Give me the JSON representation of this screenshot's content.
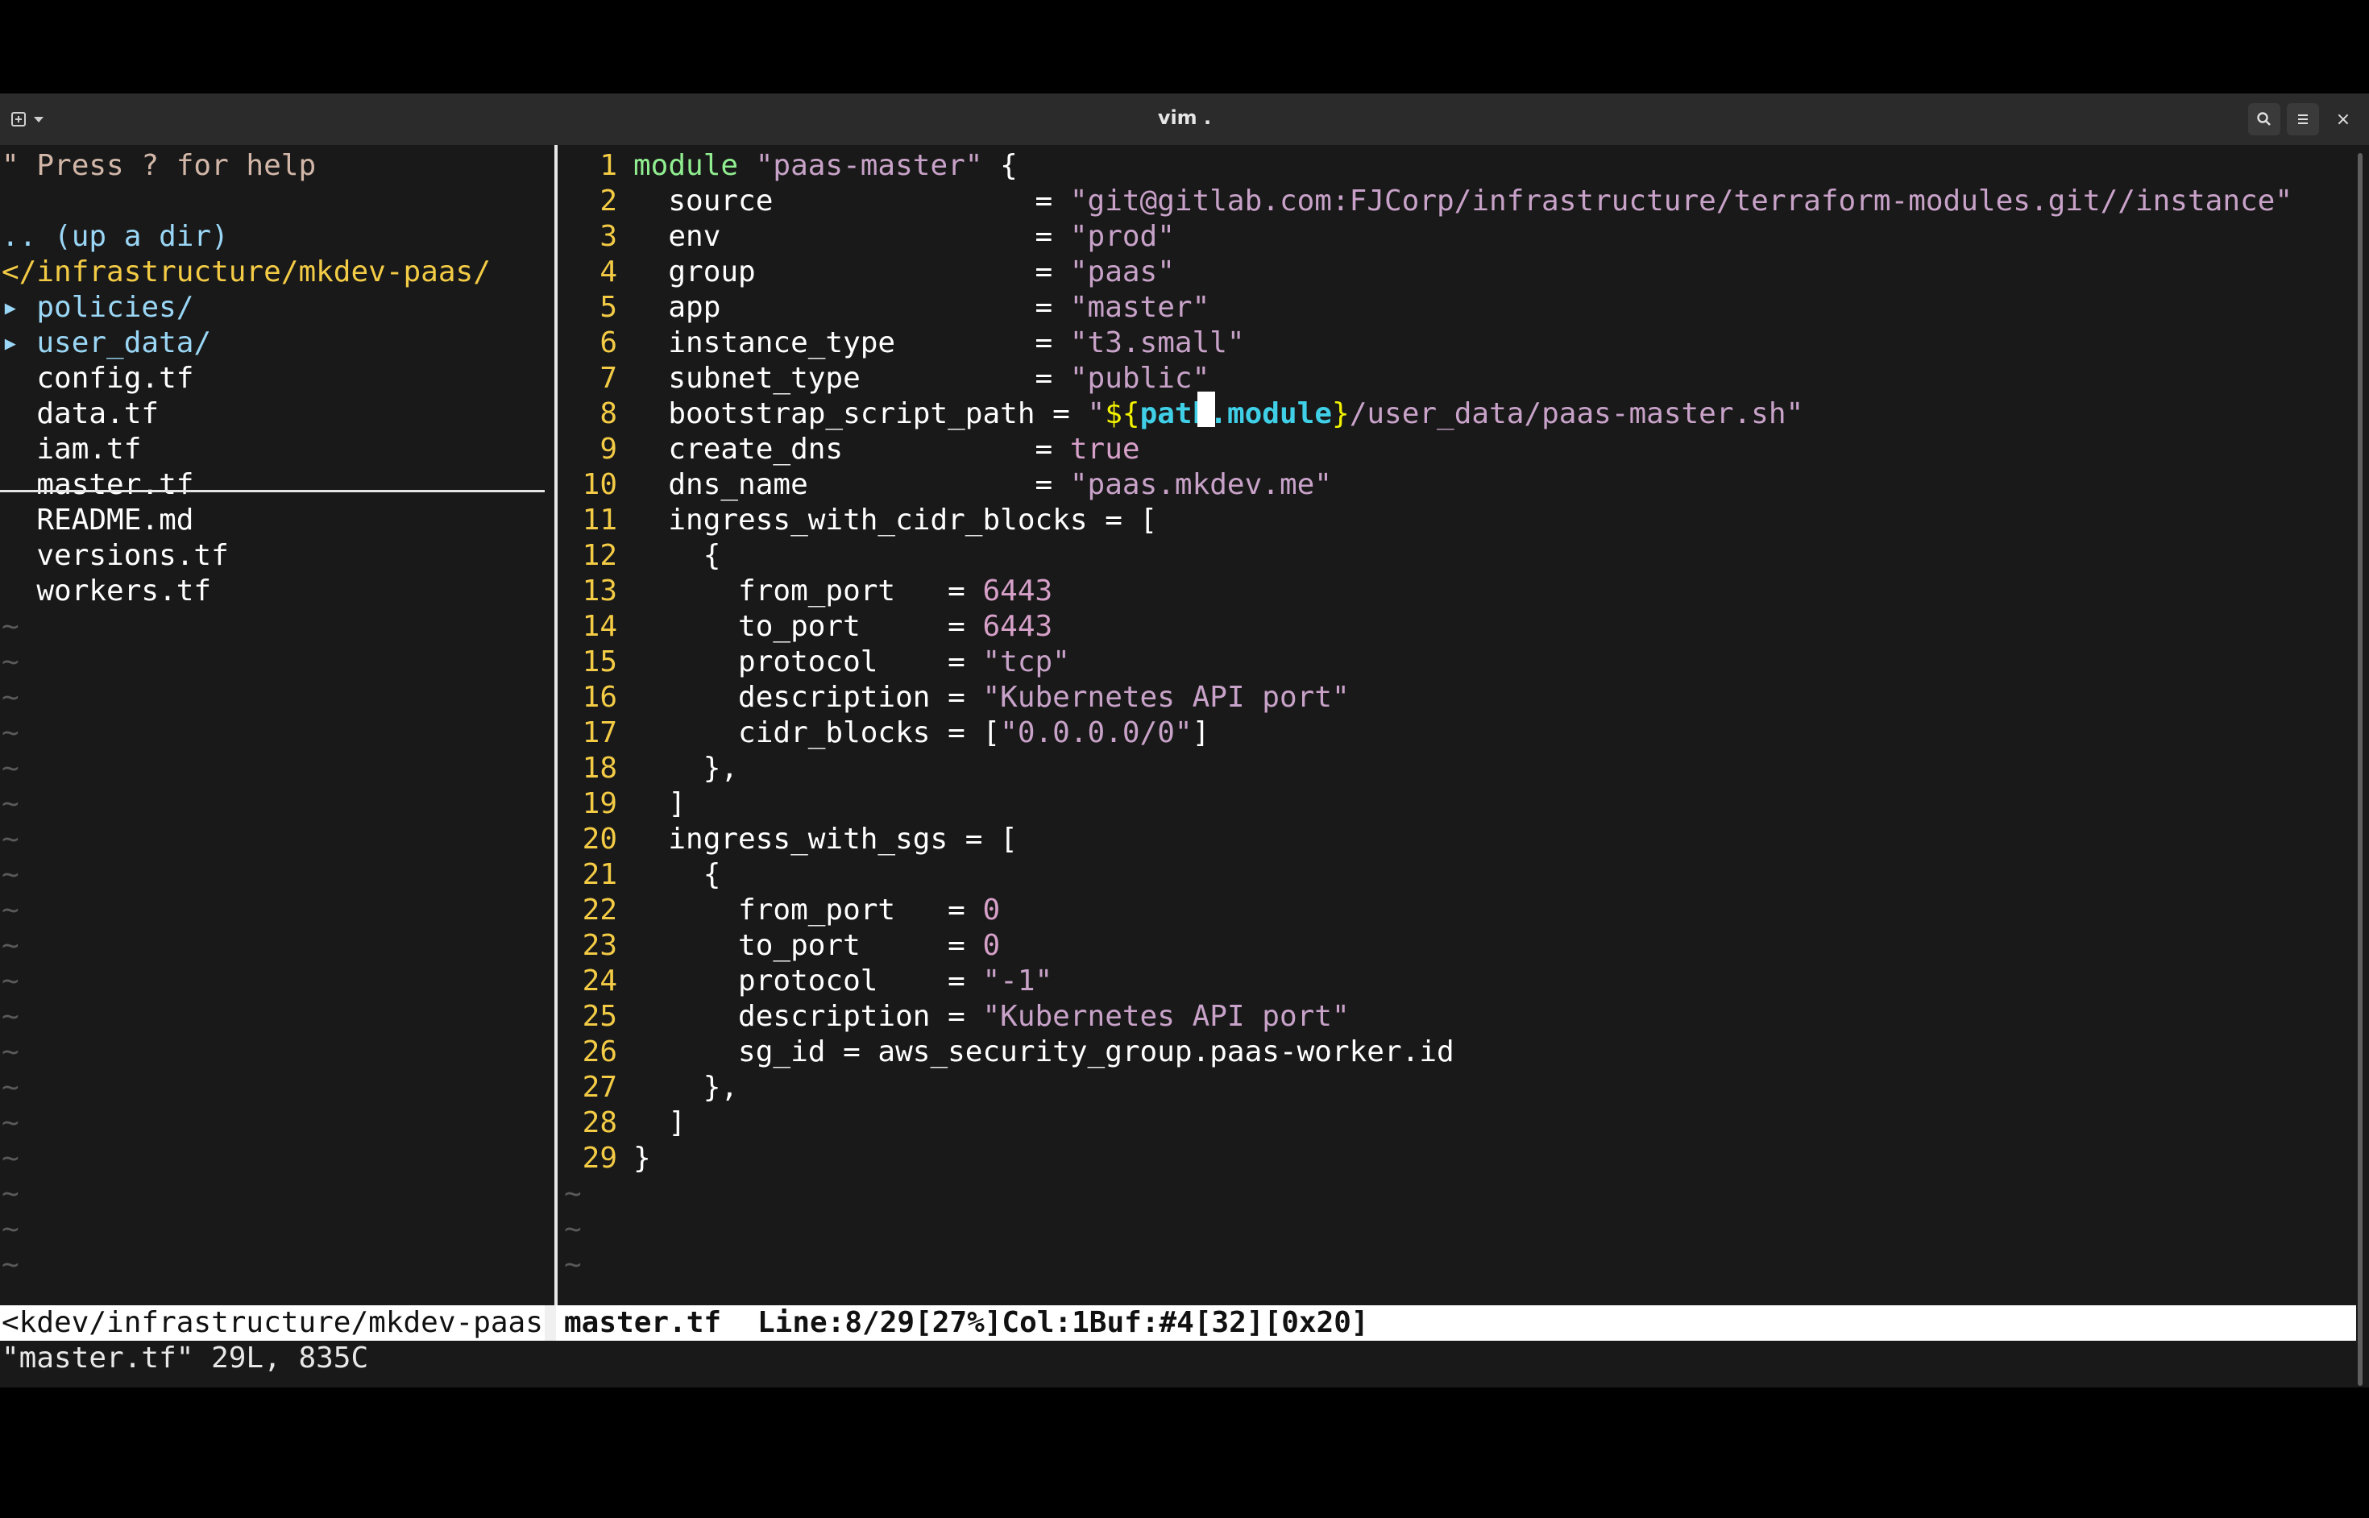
{
  "window": {
    "title": "vim .",
    "new_tab_icon": "new-tab-icon",
    "dropdown_icon": "chevron-down-icon",
    "search_icon": "search-icon",
    "menu_icon": "hamburger-menu-icon",
    "close_icon": "close-icon",
    "close_glyph": "×"
  },
  "tree": {
    "help": "\" Press ? for help",
    "updir": ".. (up a dir)",
    "cwd": "</infrastructure/mkdev-paas/",
    "dirs": [
      "▸ policies/",
      "▸ user_data/"
    ],
    "files": [
      "  config.tf",
      "  data.tf",
      "  iam.tf",
      "  master.tf",
      "  README.md",
      "  versions.tf",
      "  workers.tf"
    ],
    "tilde": "~"
  },
  "editor": {
    "line_numbers": [
      "1",
      "2",
      "3",
      "4",
      "5",
      "6",
      "7",
      "8",
      "9",
      "10",
      "11",
      "12",
      "13",
      "14",
      "15",
      "16",
      "17",
      "18",
      "19",
      "20",
      "21",
      "22",
      "23",
      "24",
      "25",
      "26",
      "27",
      "28",
      "29"
    ],
    "lines": [
      [
        [
          "module ",
          "s-mod"
        ],
        [
          "\"paas-master\"",
          "s-str"
        ],
        [
          " {",
          "s-plain"
        ]
      ],
      [
        [
          "  source               = ",
          "s-plain"
        ],
        [
          "\"git@gitlab.com:FJCorp/infrastructure/terraform-modules.git//instance\"",
          "s-str"
        ]
      ],
      [
        [
          "  env                  = ",
          "s-plain"
        ],
        [
          "\"prod\"",
          "s-str"
        ]
      ],
      [
        [
          "  group                = ",
          "s-plain"
        ],
        [
          "\"paas\"",
          "s-str"
        ]
      ],
      [
        [
          "  app                  = ",
          "s-plain"
        ],
        [
          "\"master\"",
          "s-str"
        ]
      ],
      [
        [
          "  instance_type        = ",
          "s-plain"
        ],
        [
          "\"t3.small\"",
          "s-str"
        ]
      ],
      [
        [
          "  subnet_type          = ",
          "s-plain"
        ],
        [
          "\"public\"",
          "s-str"
        ]
      ],
      [
        [
          "  bootstrap_script_path = ",
          "s-plain"
        ],
        [
          "\"",
          "s-str"
        ],
        [
          "${",
          "s-interp"
        ],
        [
          "path.module",
          "s-interp-b"
        ],
        [
          "}",
          "s-interp"
        ],
        [
          "/user_data/paas-master.sh\"",
          "s-str"
        ]
      ],
      [
        [
          "  create_dns           = ",
          "s-plain"
        ],
        [
          "true",
          "s-num"
        ]
      ],
      [
        [
          "  dns_name             = ",
          "s-plain"
        ],
        [
          "\"paas.mkdev.me\"",
          "s-str"
        ]
      ],
      [
        [
          "  ingress_with_cidr_blocks = [",
          "s-plain"
        ]
      ],
      [
        [
          "    {",
          "s-plain"
        ]
      ],
      [
        [
          "      from_port   = ",
          "s-plain"
        ],
        [
          "6443",
          "s-num"
        ]
      ],
      [
        [
          "      to_port     = ",
          "s-plain"
        ],
        [
          "6443",
          "s-num"
        ]
      ],
      [
        [
          "      protocol    = ",
          "s-plain"
        ],
        [
          "\"tcp\"",
          "s-str"
        ]
      ],
      [
        [
          "      description = ",
          "s-plain"
        ],
        [
          "\"Kubernetes API port\"",
          "s-str"
        ]
      ],
      [
        [
          "      cidr_blocks = [",
          "s-plain"
        ],
        [
          "\"0.0.0.0/0\"",
          "s-str"
        ],
        [
          "]",
          "s-plain"
        ]
      ],
      [
        [
          "    },",
          "s-plain"
        ]
      ],
      [
        [
          "  ]",
          "s-plain"
        ]
      ],
      [
        [
          "  ingress_with_sgs = [",
          "s-plain"
        ]
      ],
      [
        [
          "    {",
          "s-plain"
        ]
      ],
      [
        [
          "      from_port   = ",
          "s-plain"
        ],
        [
          "0",
          "s-num"
        ]
      ],
      [
        [
          "      to_port     = ",
          "s-plain"
        ],
        [
          "0",
          "s-num"
        ]
      ],
      [
        [
          "      protocol    = ",
          "s-plain"
        ],
        [
          "\"-1\"",
          "s-str"
        ]
      ],
      [
        [
          "      description = ",
          "s-plain"
        ],
        [
          "\"Kubernetes API port\"",
          "s-str"
        ]
      ],
      [
        [
          "      sg_id = aws_security_group.paas-worker.id",
          "s-plain"
        ]
      ],
      [
        [
          "    },",
          "s-plain"
        ]
      ],
      [
        [
          "  ]",
          "s-plain"
        ]
      ],
      [
        [
          "}",
          "s-plain"
        ]
      ]
    ],
    "tilde": "~"
  },
  "statusline": {
    "left": "<kdev/infrastructure/mkdev-paas",
    "file": "master.tf",
    "position": "Line:8/29[27%]Col:1Buf:#4[32][0x20]"
  },
  "cmdline": "\"master.tf\" 29L, 835C"
}
